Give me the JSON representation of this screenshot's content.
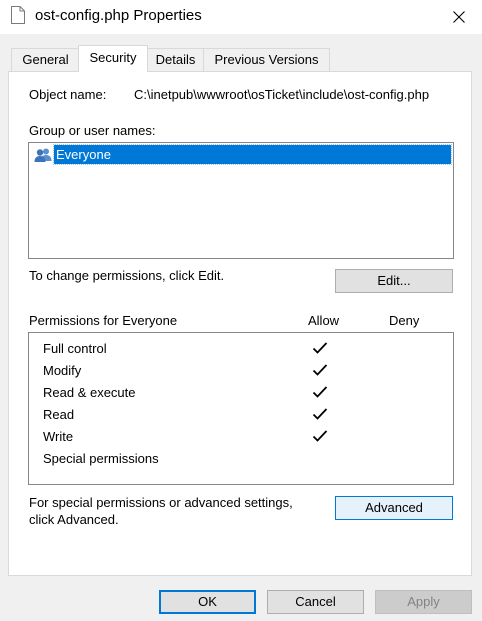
{
  "window": {
    "title": "ost-config.php Properties"
  },
  "tabs": [
    {
      "label": "General",
      "active": false
    },
    {
      "label": "Security",
      "active": true
    },
    {
      "label": "Details",
      "active": false
    },
    {
      "label": "Previous Versions",
      "active": false
    }
  ],
  "security": {
    "object_name_label": "Object name:",
    "object_name_value": "C:\\inetpub\\wwwroot\\osTicket\\include\\ost-config.php",
    "group_label": "Group or user names:",
    "groups": [
      {
        "name": "Everyone",
        "icon": "users-icon",
        "selected": true
      }
    ],
    "change_text": "To change permissions, click Edit.",
    "edit_button": "Edit...",
    "permissions_label": "Permissions for Everyone",
    "allow_header": "Allow",
    "deny_header": "Deny",
    "permissions": [
      {
        "name": "Full control",
        "allow": true,
        "deny": false
      },
      {
        "name": "Modify",
        "allow": true,
        "deny": false
      },
      {
        "name": "Read & execute",
        "allow": true,
        "deny": false
      },
      {
        "name": "Read",
        "allow": true,
        "deny": false
      },
      {
        "name": "Write",
        "allow": true,
        "deny": false
      },
      {
        "name": "Special permissions",
        "allow": false,
        "deny": false
      }
    ],
    "advanced_text_line1": "For special permissions or advanced settings,",
    "advanced_text_line2": "click Advanced.",
    "advanced_button": "Advanced"
  },
  "footer": {
    "ok": "OK",
    "cancel": "Cancel",
    "apply": "Apply",
    "apply_enabled": false
  },
  "colors": {
    "selection": "#0078d7",
    "primary_border": "#0078d7",
    "dialog_bg": "#f0f0f0"
  }
}
